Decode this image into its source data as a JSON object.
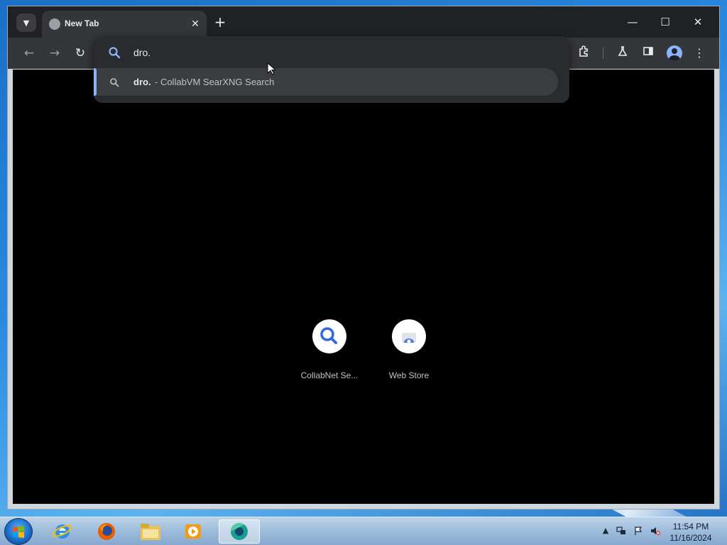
{
  "browser": {
    "tab_title": "New Tab",
    "tab_close_glyph": "✕",
    "new_tab_glyph": "+",
    "window_controls": {
      "minimize": "—",
      "maximize": "☐",
      "close": "✕"
    },
    "nav": {
      "back": "←",
      "forward": "→",
      "reload": "↻"
    },
    "toolbar_icons": [
      "extensions-icon",
      "labs-flask-icon",
      "side-panel-icon",
      "profile-avatar-icon",
      "more-menu-icon"
    ],
    "accent_color": "#8ab4f8"
  },
  "omnibox": {
    "value": "dro.",
    "suggestion": {
      "query": "dro.",
      "description": "- CollabVM SearXNG Search"
    }
  },
  "shortcuts": [
    {
      "label": "CollabNet Se...",
      "icon": "search-magnifier-icon"
    },
    {
      "label": "Web Store",
      "icon": "web-store-icon"
    }
  ],
  "taskbar": {
    "apps": [
      "internet-explorer-icon",
      "firefox-icon",
      "file-explorer-icon",
      "media-player-icon",
      "chromium-icon"
    ],
    "clock": {
      "time": "11:54 PM",
      "date": "11/16/2024"
    }
  }
}
